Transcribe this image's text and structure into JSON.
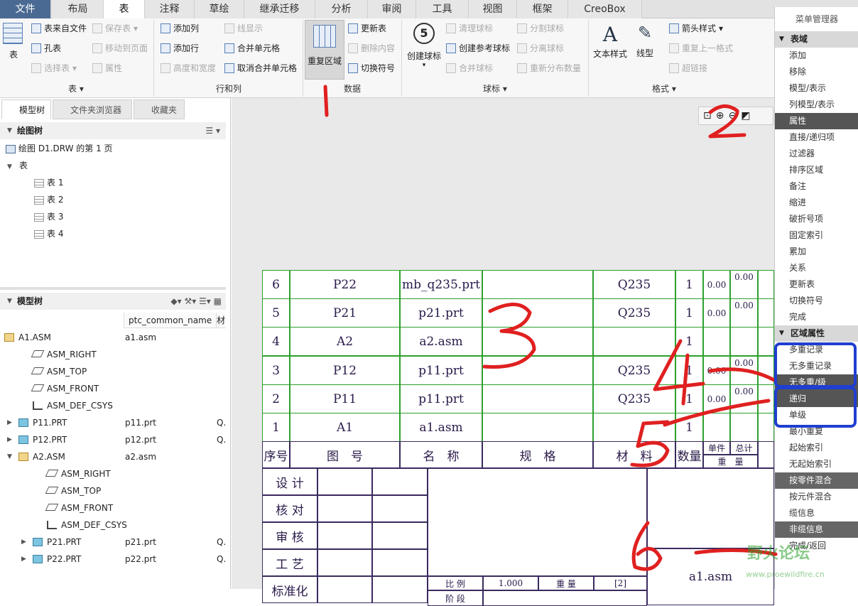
{
  "menubar": {
    "tabs": [
      "文件",
      "布局",
      "表",
      "注释",
      "草绘",
      "继承迁移",
      "分析",
      "审阅",
      "工具",
      "视图",
      "框架",
      "CreoBox"
    ],
    "active": "表"
  },
  "ribbon": {
    "table_group": {
      "big_btn": "表",
      "items": [
        "表来自文件",
        "孔表",
        "选择表",
        "保存表",
        "移动到页面",
        "属性"
      ],
      "label": "表"
    },
    "rowcol_group": {
      "items": [
        "添加列",
        "添加行",
        "高度和宽度",
        "线显示",
        "合并单元格",
        "取消合并单元格"
      ],
      "label": "行和列"
    },
    "data_group": {
      "big_btn": "重复区域",
      "items": [
        "更新表",
        "删除内容",
        "切换符号"
      ],
      "label": "数据"
    },
    "balloon_group": {
      "big_btn": "创建球标",
      "items": [
        "清理球标",
        "创建参考球标",
        "合并球标",
        "分割球标",
        "分离球标",
        "重新分布数量"
      ],
      "label": "球标"
    },
    "format_group": {
      "big1": "文本样式",
      "big2": "线型",
      "items": [
        "箭头样式",
        "重复上一格式",
        "超链接"
      ],
      "label": "格式"
    }
  },
  "leftpanel": {
    "tabs": [
      "模型树",
      "文件夹浏览器",
      "收藏夹"
    ],
    "drawing_tree": {
      "title": "绘图树",
      "page": "绘图 D1.DRW 的第 1 页",
      "tables_folder": "表",
      "tables": [
        "表 1",
        "表 2",
        "表 3",
        "表 4"
      ]
    },
    "model_tree": {
      "title": "模型树",
      "col2": "ptc_common_name",
      "col3": "材",
      "rows": [
        {
          "name": "A1.ASM",
          "c2": "a1.asm",
          "c3": ""
        },
        {
          "name": "ASM_RIGHT",
          "c2": "",
          "c3": ""
        },
        {
          "name": "ASM_TOP",
          "c2": "",
          "c3": ""
        },
        {
          "name": "ASM_FRONT",
          "c2": "",
          "c3": ""
        },
        {
          "name": "ASM_DEF_CSYS",
          "c2": "",
          "c3": ""
        },
        {
          "name": "P11.PRT",
          "c2": "p11.prt",
          "c3": "Q."
        },
        {
          "name": "P12.PRT",
          "c2": "p12.prt",
          "c3": "Q."
        },
        {
          "name": "A2.ASM",
          "c2": "a2.asm",
          "c3": ""
        },
        {
          "name": "ASM_RIGHT",
          "c2": "",
          "c3": ""
        },
        {
          "name": "ASM_TOP",
          "c2": "",
          "c3": ""
        },
        {
          "name": "ASM_FRONT",
          "c2": "",
          "c3": ""
        },
        {
          "name": "ASM_DEF_CSYS",
          "c2": "",
          "c3": ""
        },
        {
          "name": "P21.PRT",
          "c2": "p21.prt",
          "c3": "Q."
        },
        {
          "name": "P22.PRT",
          "c2": "p22.prt",
          "c3": "Q."
        }
      ]
    }
  },
  "bom": {
    "rows": [
      {
        "no": "6",
        "code": "P22",
        "name": "mb_q235.prt",
        "spec": "",
        "mat": "Q235",
        "qty": "1",
        "unit": "0.00",
        "total": "0.00"
      },
      {
        "no": "5",
        "code": "P21",
        "name": "p21.prt",
        "spec": "",
        "mat": "Q235",
        "qty": "1",
        "unit": "0.00",
        "total": "0.00"
      },
      {
        "no": "4",
        "code": "A2",
        "name": "a2.asm",
        "spec": "",
        "mat": "",
        "qty": "1",
        "unit": "",
        "total": ""
      },
      {
        "no": "3",
        "code": "P12",
        "name": "p11.prt",
        "spec": "",
        "mat": "Q235",
        "qty": "1",
        "unit": "0.00",
        "total": "0.00"
      },
      {
        "no": "2",
        "code": "P11",
        "name": "p11.prt",
        "spec": "",
        "mat": "Q235",
        "qty": "1",
        "unit": "0.00",
        "total": "0.00"
      },
      {
        "no": "1",
        "code": "A1",
        "name": "a1.asm",
        "spec": "",
        "mat": "",
        "qty": "1",
        "unit": "",
        "total": ""
      }
    ],
    "header": {
      "no": "序号",
      "code": "图　号",
      "name": "名　称",
      "spec": "规　格",
      "mat": "材　料",
      "qty": "数量",
      "unit": "单件",
      "total": "总计",
      "weight": "重　量"
    },
    "title_block": {
      "labels": [
        "设 计",
        "核 对",
        "审 核",
        "工 艺",
        "标准化"
      ],
      "scale_label": "比 例",
      "scale_value": "1.000",
      "weight_label": "重 量",
      "weight_value": "[2]",
      "stage_label": "阶 段",
      "model_name": "a1.asm"
    }
  },
  "rightmenu": {
    "title": "菜单管理器",
    "sec1": "表域",
    "items1": [
      "添加",
      "移除",
      "模型/表示",
      "列模型/表示",
      "属性",
      "直接/递归项",
      "过滤器",
      "排序区域",
      "备注",
      "缩进",
      "破折号项",
      "固定索引",
      "累加",
      "关系",
      "更新表",
      "切换符号",
      "完成"
    ],
    "sec2": "区域属性",
    "items2": [
      "多重记录",
      "无多重记录",
      "无多重/级",
      "递归",
      "单级",
      "最小重复",
      "起始索引",
      "无起始索引",
      "按零件混合",
      "按元件混合",
      "缆信息",
      "非缆信息",
      "完成/返回"
    ]
  },
  "annotations": {
    "marks": [
      "1",
      "2",
      "3",
      "4",
      "5",
      "6"
    ]
  },
  "watermark": {
    "main": "野火论坛",
    "url": "www.proewildfire.cn"
  }
}
